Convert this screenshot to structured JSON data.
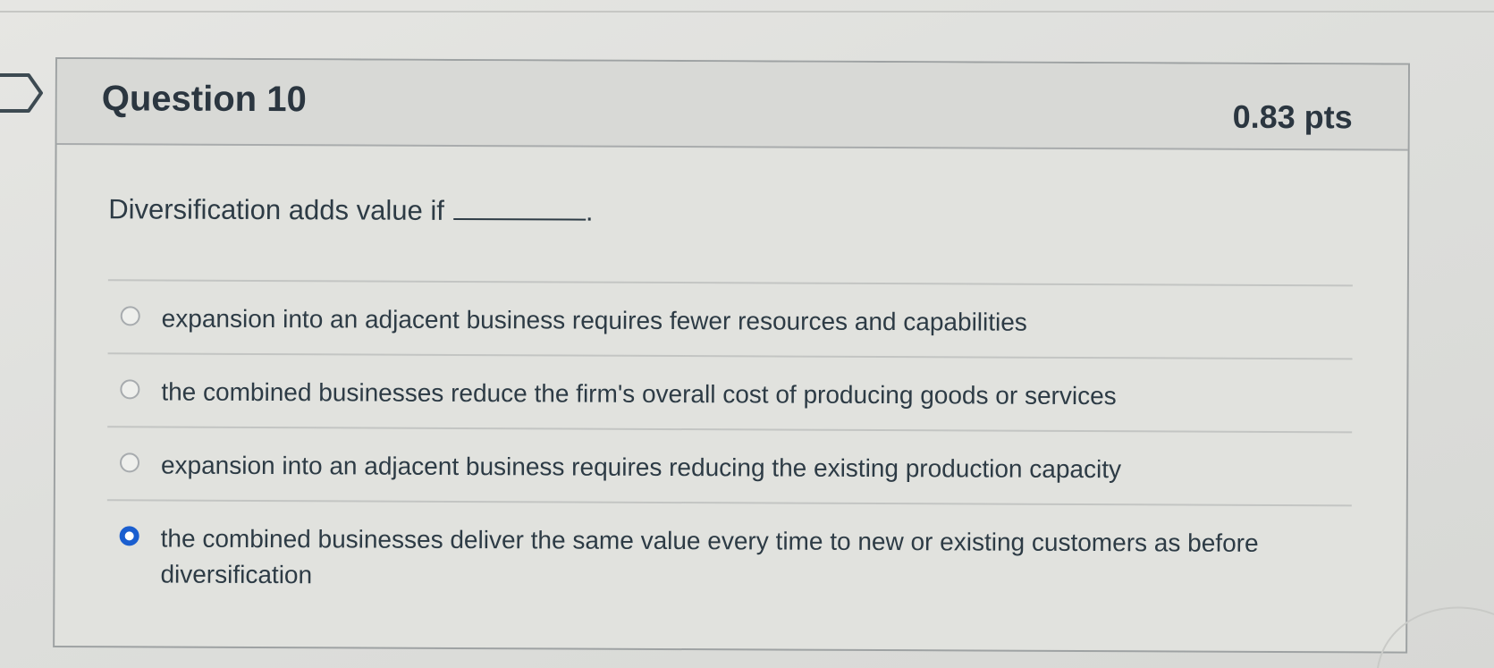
{
  "question": {
    "title": "Question 10",
    "points": "0.83 pts",
    "prompt": "Diversification adds value if",
    "prompt_end": ".",
    "answers": [
      {
        "text": "expansion into an adjacent business requires fewer resources and capabilities",
        "selected": false
      },
      {
        "text": "the combined businesses reduce the firm's overall cost of producing goods or services",
        "selected": false
      },
      {
        "text": "expansion into an adjacent business requires reducing the existing production capacity",
        "selected": false
      },
      {
        "text": "the combined businesses deliver the same value every time to new or existing customers as before diversification",
        "selected": true
      }
    ]
  },
  "colors": {
    "selected_radio": "#1a5ecf",
    "text": "#2d3b45",
    "border": "#9ea2a3"
  },
  "icons": {
    "flag": "flag-outline-icon"
  }
}
